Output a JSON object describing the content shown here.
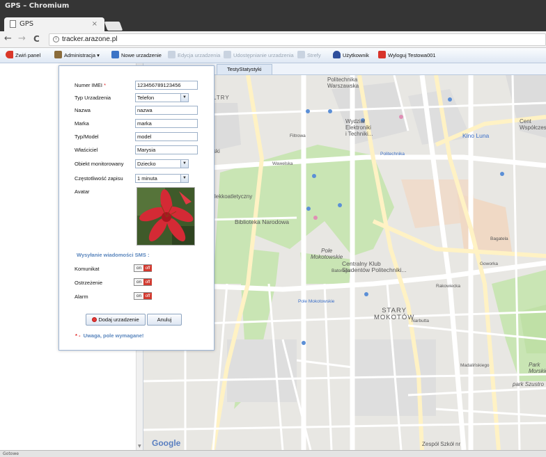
{
  "window": {
    "title": "GPS – Chromium"
  },
  "browser": {
    "tab_title": "GPS",
    "tab_close": "×",
    "url": "tracker.arazone.pl",
    "back": "←",
    "forward": "→",
    "reload": "C",
    "info": "i"
  },
  "toolbar": {
    "collapse_panel": "Zwiń panel",
    "administration": "Administracja",
    "administration_arrow": "▾",
    "new_device": "Nowe urzadzenie",
    "edit_device": "Edycja urzadzenia",
    "share_device": "Udostępnianie urzadzenia",
    "zones": "Strefy",
    "user": "Użytkownik",
    "logout": "Wyloguj Testowa001"
  },
  "map_tabs": {
    "stats": "TestyStatystyki"
  },
  "form": {
    "imei_label": "Numer IMEI",
    "imei_required": "*",
    "imei_value": "123456789123456",
    "type_label": "Typ Urzadzenia",
    "type_value": "Telefon",
    "name_label": "Nazwa",
    "name_value": "nazwa",
    "brand_label": "Marka",
    "brand_value": "marka",
    "model_label": "Typ/Model",
    "model_value": "model",
    "owner_label": "Właściciel",
    "owner_value": "Marysia",
    "object_label": "Obiekt monitorowany",
    "object_value": "Dziecko",
    "frequency_label": "Częstotliwość zapisu",
    "frequency_value": "1 minuta",
    "avatar_label": "Avatar",
    "sms_heading": "Wysyłanie wiadomości SMS :",
    "toggles": [
      {
        "label": "Komunikat",
        "on": "on",
        "off": "off"
      },
      {
        "label": "Ostrzeżenie",
        "on": "on",
        "off": "off"
      },
      {
        "label": "Alarm",
        "on": "on",
        "off": "off"
      }
    ],
    "add_button": "Dodaj urzadzenie",
    "cancel_button": "Anuluj",
    "note_star": "* -",
    "note_text": "Uwaga, pole wymagane!"
  },
  "map": {
    "attribution": "Google",
    "labels": {
      "politechnika": "Politechnika\nWarszawska",
      "wydzial": "Wydział\nElektroniki\ni Techniki...",
      "kino": "Kino Luna",
      "biblioteka": "Biblioteka Narodowa",
      "klub": "Centralny Klub\nStudentów Politechniki...",
      "pole": "Pole\nMokotowskie",
      "stary": "STARY\nMOKOTÓW",
      "pole_metro": "Pole Mokotowskie",
      "wawelska": "Wawelska",
      "filtrowa": "Filtrowa",
      "batorego": "Batorego",
      "rakowiecka": "Rakowiecka",
      "narbutta": "Narbutta",
      "madalinskiego": "Madalińskiego",
      "park": "Park\nMorskie O",
      "park_sz": "park Szustro",
      "ltry": "LTRY",
      "lekkoatl": "lekkoatletyczny",
      "ski": "ski",
      "cent": "Cent\nWspółczesn",
      "zespol": "Zespół Szkół nr",
      "bagatela": "Bagatela",
      "goworka": "Goworka",
      "pol_metro": "Politechnika"
    }
  },
  "colors": {
    "park_green": "#c8e6b0",
    "road_yellow": "#fce8b2",
    "accent_blue": "#5a86bd",
    "toggle_red": "#d23a30"
  },
  "status": {
    "text": "Gotowe"
  }
}
